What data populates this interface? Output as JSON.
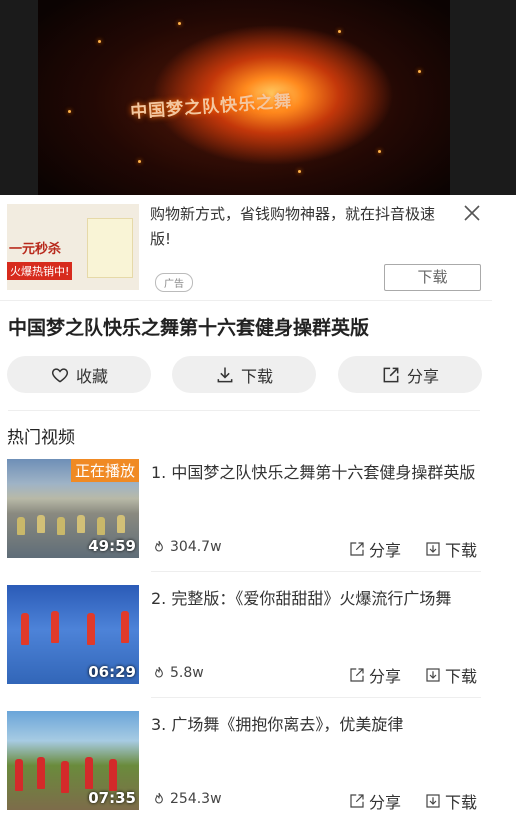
{
  "player": {
    "video_caption": "中国梦之队快乐之舞",
    "accent_color": "#ff8a1e"
  },
  "ad": {
    "thumb_line1": "一元秒杀",
    "thumb_line2": "火爆热销中!",
    "text": "购物新方式，省钱购物神器，就在抖音极速版!",
    "badge": "广告",
    "download_label": "下载",
    "close_icon": "close-icon"
  },
  "video": {
    "title": "中国梦之队快乐之舞第十六套健身操群英版"
  },
  "actions": {
    "favorite": "收藏",
    "download": "下载",
    "share": "分享"
  },
  "section_title": "热门视频",
  "hot_videos": [
    {
      "title": "1. 中国梦之队快乐之舞第十六套健身操群英版",
      "views": "304.7w",
      "duration": "49:59",
      "badge": "正在播放",
      "share_label": "分享",
      "download_label": "下载"
    },
    {
      "title": "2. 完整版：《爱你甜甜甜》火爆流行广场舞",
      "views": "5.8w",
      "duration": "06:29",
      "share_label": "分享",
      "download_label": "下载"
    },
    {
      "title": "3. 广场舞《拥抱你离去》，优美旋律",
      "views": "254.3w",
      "duration": "07:35",
      "share_label": "分享",
      "download_label": "下载"
    }
  ]
}
